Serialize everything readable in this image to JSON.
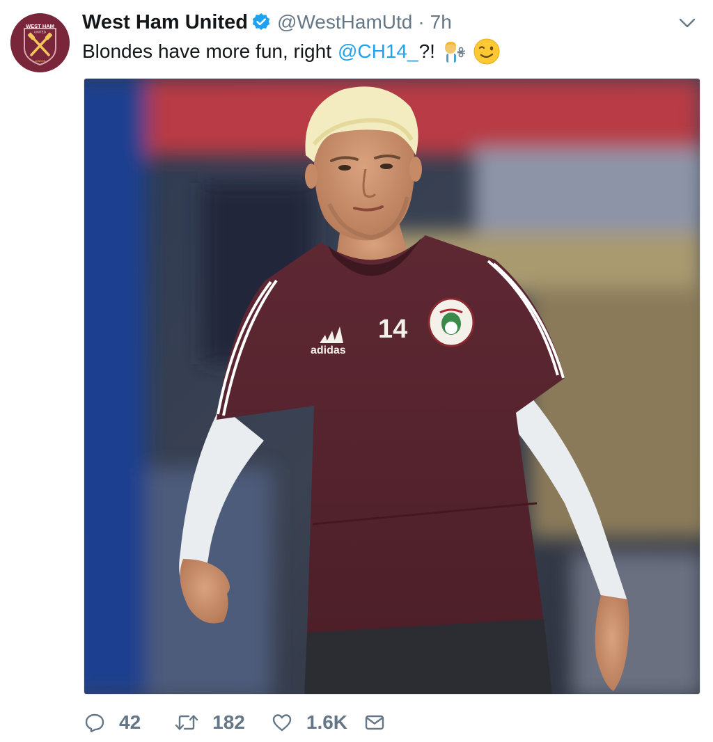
{
  "tweet": {
    "display_name": "West Ham United",
    "handle": "@WestHamUtd",
    "separator": "·",
    "time": "7h",
    "text_before": "Blondes have more fun, right",
    "mention": "@CH14_",
    "text_after": "?!",
    "emojis": [
      "hairdresser-emoji",
      "winking-face-emoji"
    ],
    "avatar": {
      "top_text": "WEST HAM",
      "sub_text": "UNITED",
      "bottom_text": "LONDON",
      "brand_color": "#7a263a"
    },
    "media": {
      "shirt_number": "14",
      "shirt_brand": "adidas",
      "shirt_color": "#5a2630",
      "hair_color": "#f2ecc0"
    }
  },
  "actions": {
    "replies": "42",
    "retweets": "182",
    "likes": "1.6K"
  },
  "colors": {
    "text": "#14171a",
    "secondary": "#657786",
    "link": "#1da1f2",
    "verified": "#1da1f2"
  }
}
